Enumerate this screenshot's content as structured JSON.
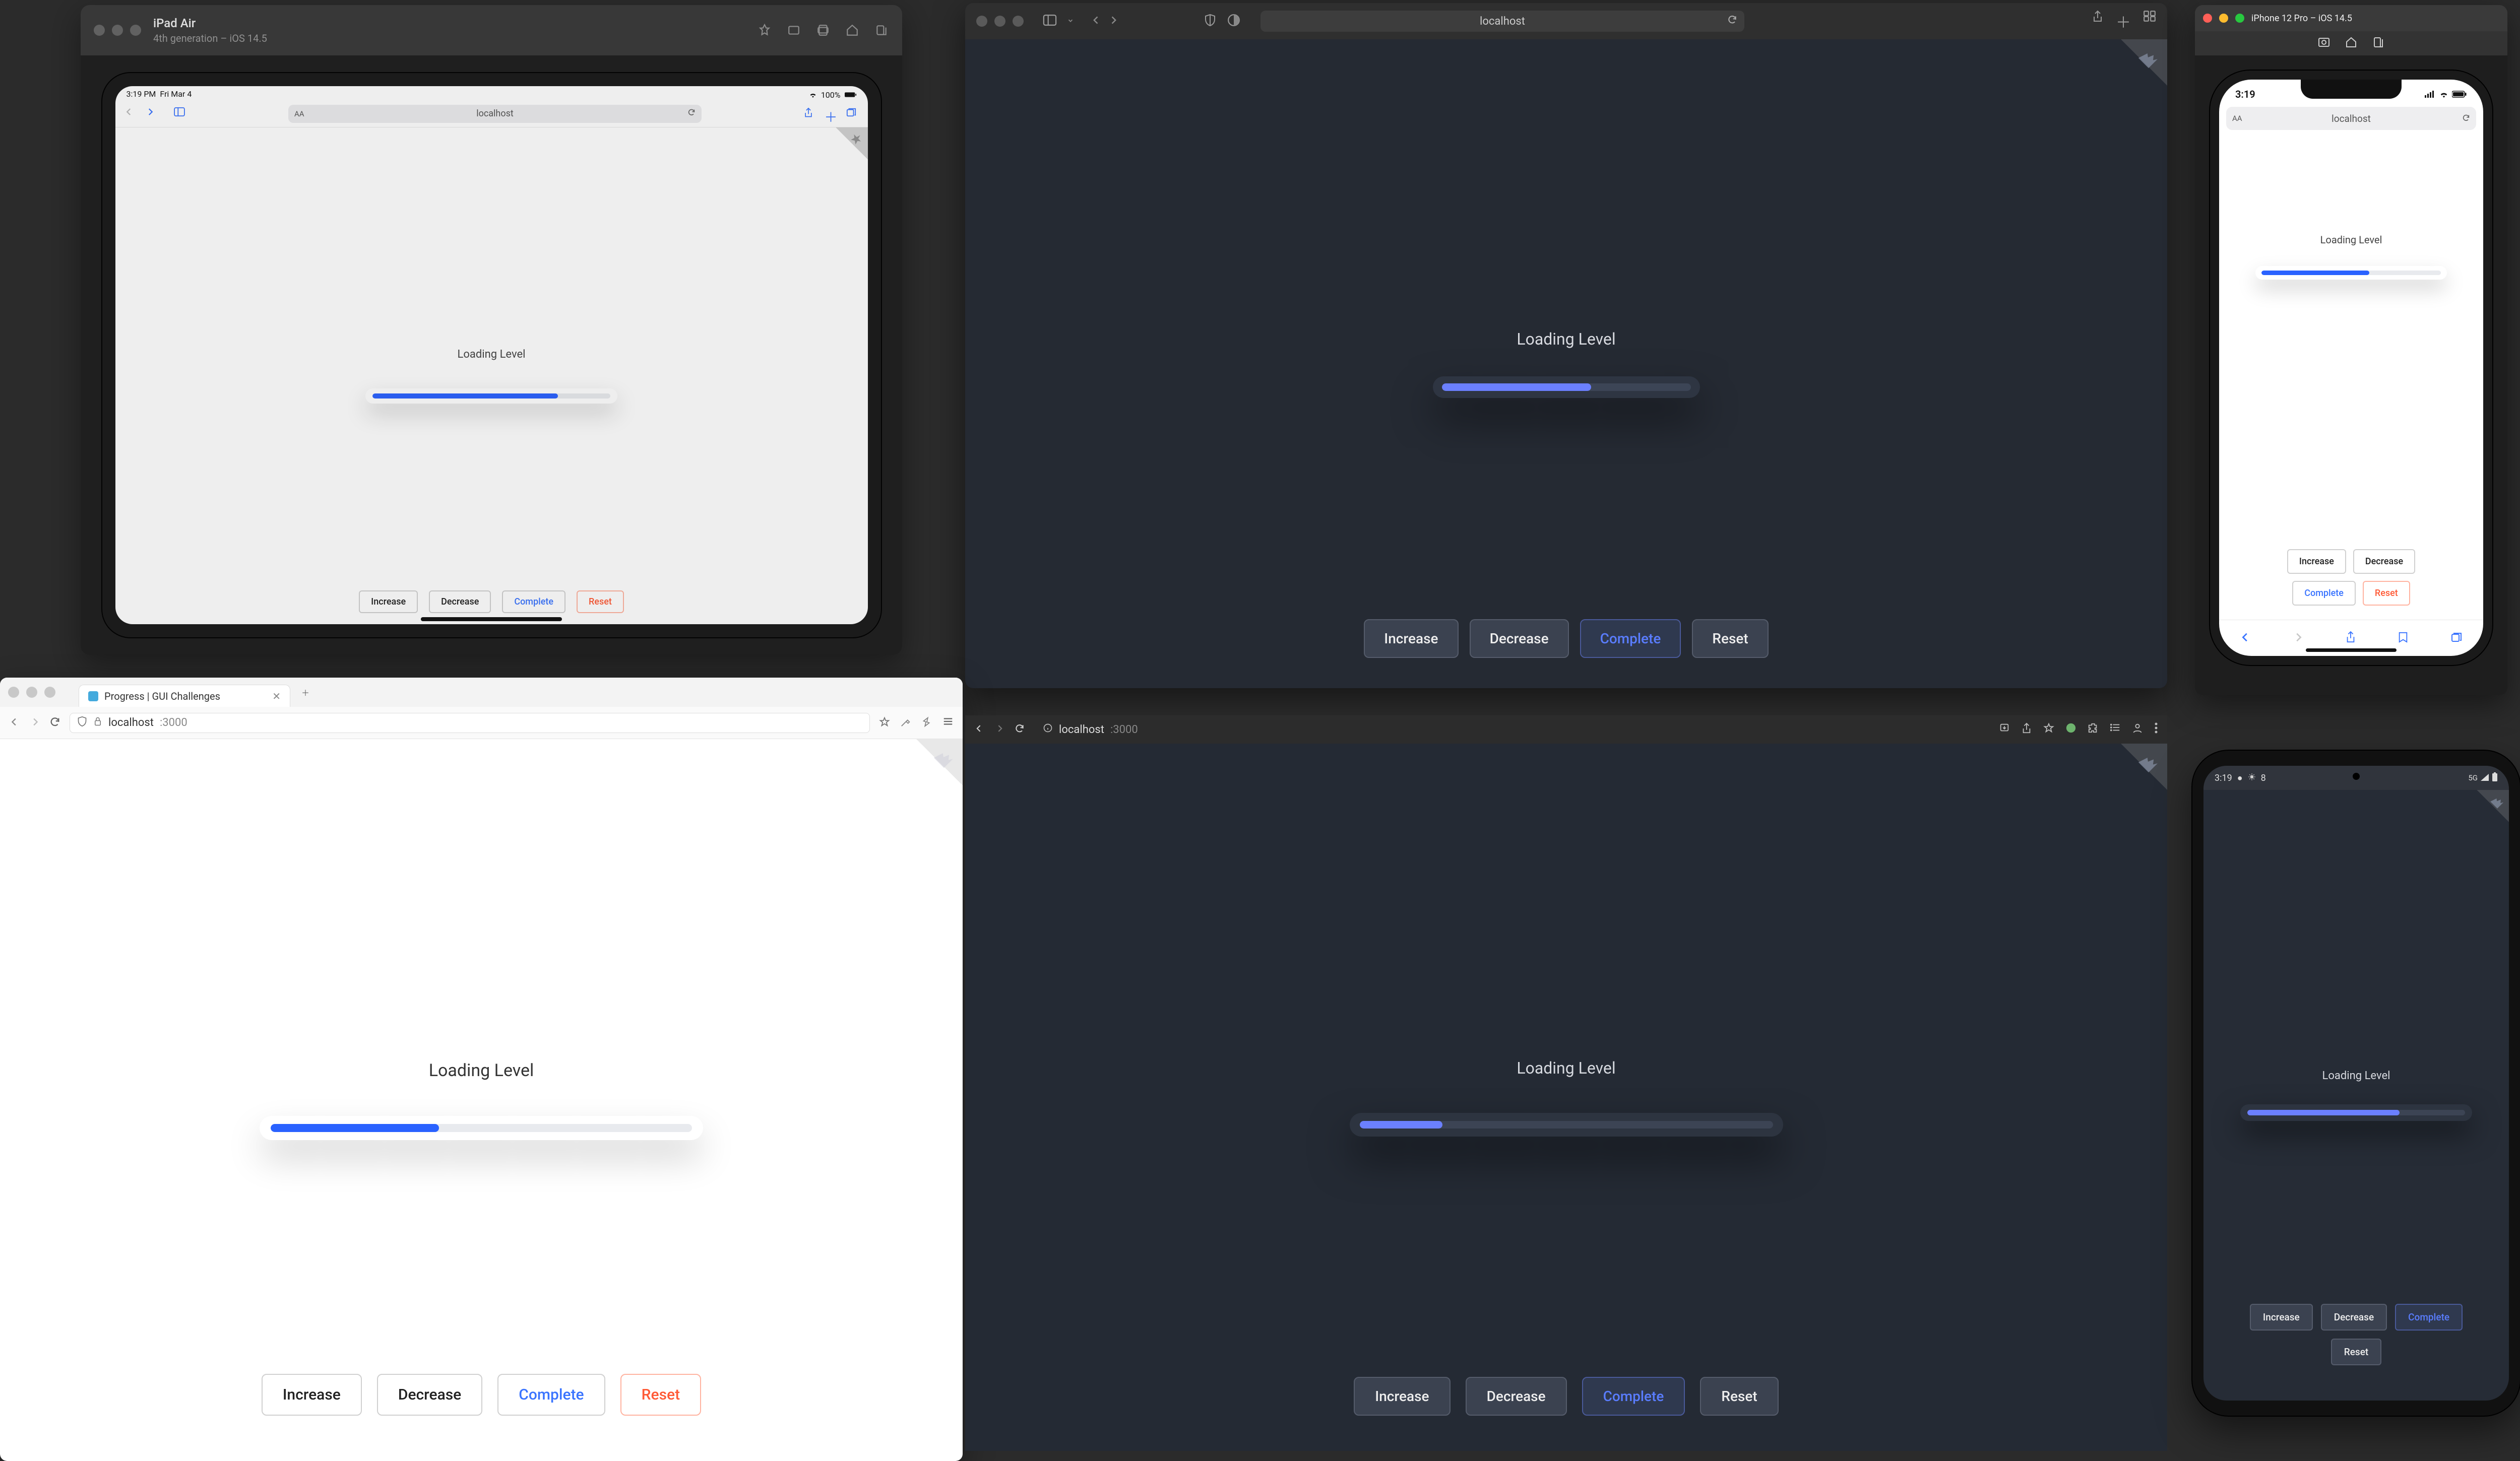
{
  "ipad": {
    "title_main": "iPad Air",
    "title_sub": "4th generation – iOS 14.5",
    "status_time": "3:19 PM",
    "status_date": "Fri Mar 4",
    "status_batt": "100%",
    "url": "localhost",
    "aa": "AA",
    "loading_label": "Loading Level",
    "progress_pct": 78,
    "buttons": {
      "increase": "Increase",
      "decrease": "Decrease",
      "complete": "Complete",
      "reset": "Reset"
    }
  },
  "safari_dark": {
    "url": "localhost",
    "loading_label": "Loading Level",
    "progress_pct": 60,
    "buttons": {
      "increase": "Increase",
      "decrease": "Decrease",
      "complete": "Complete",
      "reset": "Reset"
    }
  },
  "ff_light": {
    "tab_title": "Progress | GUI Challenges",
    "url_host": "localhost",
    "url_port": ":3000",
    "loading_label": "Loading Level",
    "progress_pct": 40,
    "buttons": {
      "increase": "Increase",
      "decrease": "Decrease",
      "complete": "Complete",
      "reset": "Reset"
    }
  },
  "chrome_dark": {
    "url_host": "localhost",
    "url_port": ":3000",
    "loading_label": "Loading Level",
    "progress_pct": 20,
    "buttons": {
      "increase": "Increase",
      "decrease": "Decrease",
      "complete": "Complete",
      "reset": "Reset"
    }
  },
  "iphone": {
    "title": "iPhone 12 Pro – iOS 14.5",
    "status_time": "3:19",
    "url": "localhost",
    "aa": "AA",
    "loading_label": "Loading Level",
    "progress_pct": 60,
    "buttons": {
      "increase": "Increase",
      "decrease": "Decrease",
      "complete": "Complete",
      "reset": "Reset"
    }
  },
  "android": {
    "status_time": "3:19",
    "status_icon_count": "8",
    "signal": "5G",
    "loading_label": "Loading Level",
    "progress_pct": 70,
    "buttons": {
      "increase": "Increase",
      "decrease": "Decrease",
      "complete": "Complete",
      "reset": "Reset"
    }
  }
}
